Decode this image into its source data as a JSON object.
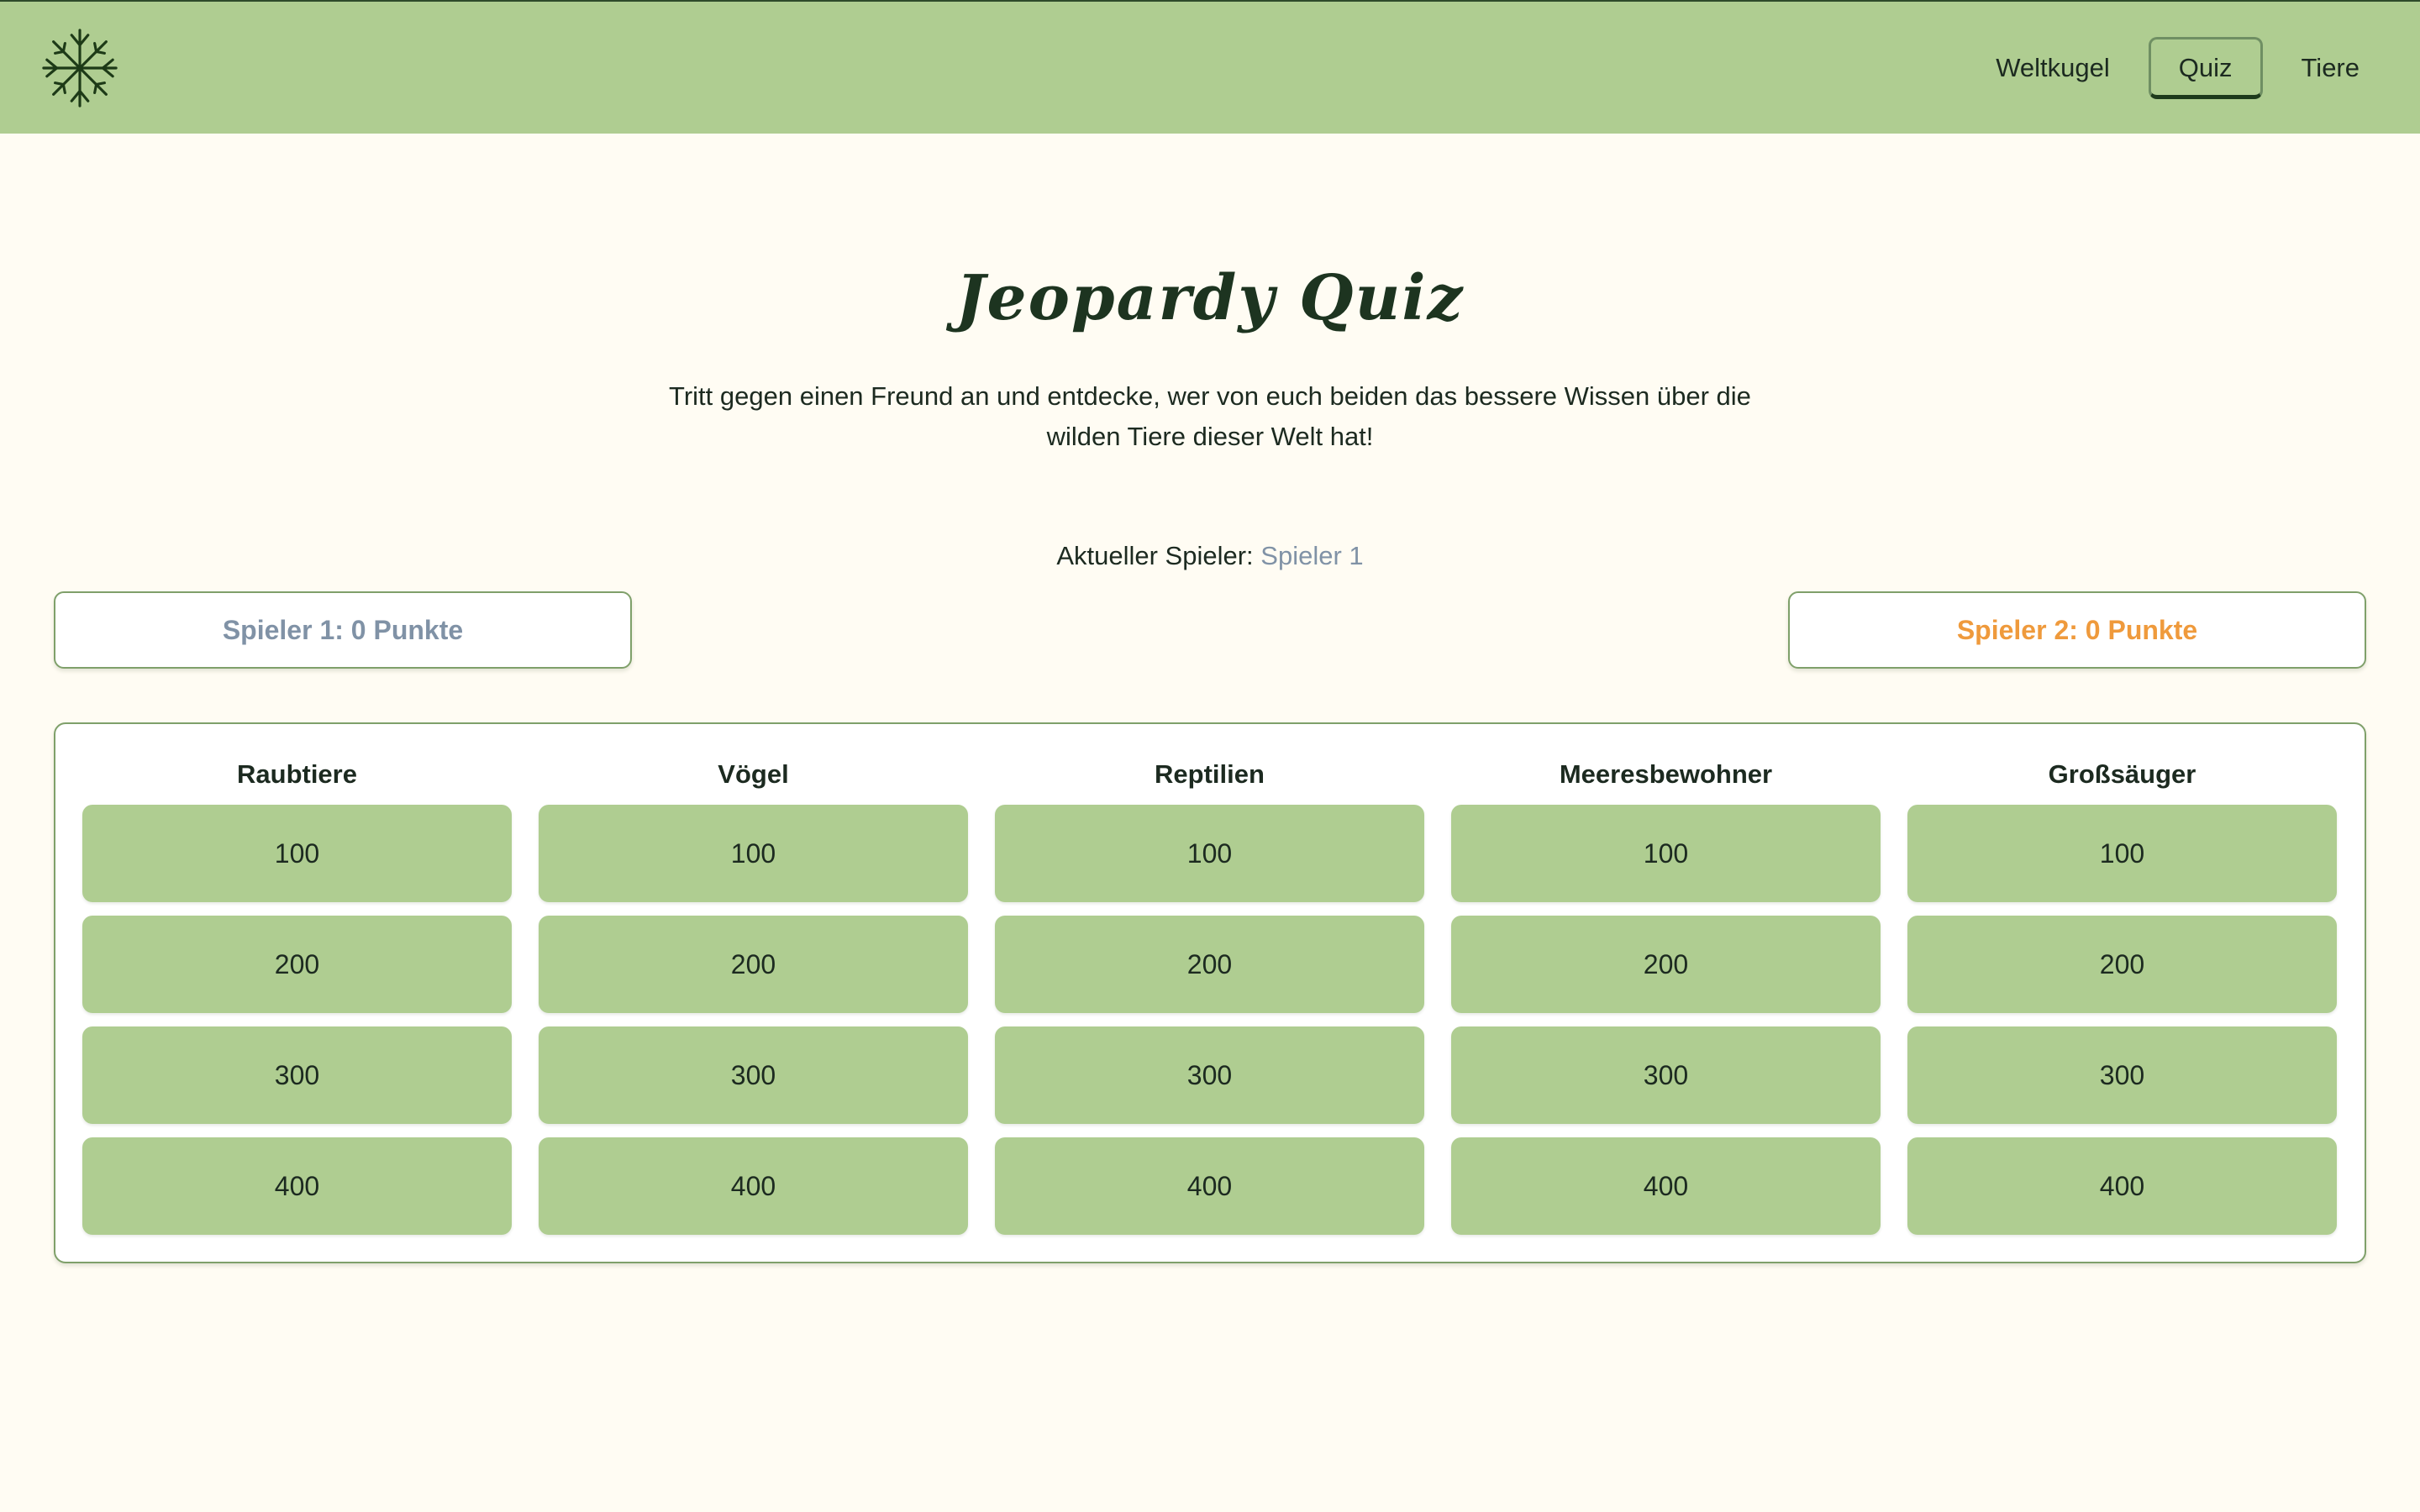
{
  "nav": {
    "items": [
      {
        "label": "Weltkugel",
        "active": false
      },
      {
        "label": "Quiz",
        "active": true
      },
      {
        "label": "Tiere",
        "active": false
      }
    ]
  },
  "page": {
    "title": "Jeopardy Quiz",
    "subtitle": "Tritt gegen einen Freund an und entdecke, wer von euch beiden das bessere Wissen über die wilden Tiere dieser Welt hat!",
    "current_player_label": "Aktueller Spieler:",
    "current_player_value": "Spieler 1"
  },
  "scores": {
    "player1": "Spieler 1: 0 Punkte",
    "player2": "Spieler 2: 0 Punkte"
  },
  "board": {
    "categories": [
      {
        "name": "Raubtiere",
        "values": [
          "100",
          "200",
          "300",
          "400"
        ]
      },
      {
        "name": "Vögel",
        "values": [
          "100",
          "200",
          "300",
          "400"
        ]
      },
      {
        "name": "Reptilien",
        "values": [
          "100",
          "200",
          "300",
          "400"
        ]
      },
      {
        "name": "Meeresbewohner",
        "values": [
          "100",
          "200",
          "300",
          "400"
        ]
      },
      {
        "name": "Großsäuger",
        "values": [
          "100",
          "200",
          "300",
          "400"
        ]
      }
    ]
  },
  "colors": {
    "header_bg": "#afcd91",
    "page_bg": "#fffcf3",
    "player1": "#8092a6",
    "player2": "#ef9a3c",
    "tile": "#afcd91"
  },
  "icons": {
    "logo": "plant-roots-logo"
  }
}
